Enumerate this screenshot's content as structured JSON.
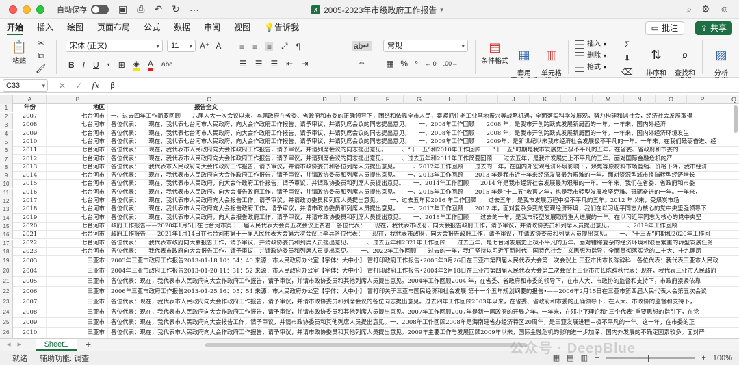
{
  "titlebar": {
    "autosave_label": "自动保存",
    "doc_title": "2005-2023年市级政府工作报告",
    "doc_badge": "X"
  },
  "menu": {
    "tabs": [
      "开始",
      "插入",
      "绘图",
      "页面布局",
      "公式",
      "数据",
      "审阅",
      "视图",
      "告诉我"
    ],
    "comment_label": "批注",
    "share_label": "共享"
  },
  "ribbon": {
    "paste_label": "粘贴",
    "font_name": "宋体 (正文)",
    "font_size": "11",
    "number_format": "常规",
    "conditional_format": "条件格式",
    "table_format": "套用\n表格格式",
    "cell_style": "单元格\n样式",
    "insert": "插入",
    "delete": "删除",
    "format": "格式",
    "sort_filter": "排序和\n筛选",
    "find_select": "查找和\n选择",
    "analyze_data": "分析\n数据"
  },
  "formula_bar": {
    "cell_ref": "C33",
    "fx": "fx",
    "value": "β"
  },
  "columns": [
    "A",
    "B",
    "C",
    "D",
    "E",
    "F",
    "G",
    "H",
    "I",
    "J",
    "K",
    "L",
    "M",
    "N",
    "O",
    "P",
    "Q"
  ],
  "sheet": {
    "header": {
      "num": "1",
      "year": "年份",
      "region": "地区",
      "text": "报告全文"
    },
    "rows": [
      {
        "num": "2",
        "year": "2007",
        "region": "七台河市",
        "text": "一、过去四年工作简要回顾　　八届人大一次会议以来，本届政府在省委、省政府和市委的正确领导下，团结和依靠全市人民，紧紧抓住老工业基地振兴等战略机遇，全面落实科学发展观，努力构建和谐社会，经济社会发展取得"
      },
      {
        "num": "3",
        "year": "2008",
        "region": "七台河市",
        "text": "各位代表：　　现在，我代表七台河市人民政府，向大会作政府工作报告，请予审议，并请列席会议的同志提出意见。　　一、2008年工作回顾　　2008 年，是我市开创跨跃式发展新局面的一年。一年来，国内外经济"
      },
      {
        "num": "4",
        "year": "2009",
        "region": "七台河市",
        "text": "各位代表：　　现在，我代表七台河市人民政府，向大会作政府工作报告，请予审议，并请列席会议的同志提出意见。　　一、2008年工作回顾　　2008 年，是我市开创跨跃式发展新局面的一年。一年来，国内外经济环境发生"
      },
      {
        "num": "5",
        "year": "2010",
        "region": "七台河市",
        "text": "各位代表：　　现在，我代表七台河市人民政府，向大会作政府工作报告，请予审议，并请列席会议的同志提出意见。　　一、2009年工作回顾　　2009年，是新世纪以来我市经济社会发展极不平凡的一年。一年来，在我们砥砺奋进、经"
      },
      {
        "num": "6",
        "year": "2011",
        "region": "七台河市",
        "text": "各位代表：　　现在，我代表市人民政府向大会作政府工作报告，请予审议，并请列席会议的同志提出意见。　　一、“十一五”和2010年工作回顾　　“十一五”时期是我市发展史上极不平凡的五年。在省委、省政府和市委的"
      },
      {
        "num": "7",
        "year": "2012",
        "region": "七台河市",
        "text": "各位代表：　　现在，我代表市人民政府向大会作政府工作报告，请予审议，并请列席会议的同志提出意见。　　一、过去五年和2011年工作简要回顾　　过去五年，是我市发展史上不平凡的五年。面对国际金融危机的严"
      },
      {
        "num": "8",
        "year": "2013",
        "region": "七台河市",
        "text": "各位代表：　　我代表市人民政府向大会作政府工作报告，请予审议，并请市政协委员和各位列席人员提出意见。　　一、2012年工作回顾　　过去的一年，在国内外宏观经济环境影响下，煤焦等原材料市场萎缩、价格下降，我市经济"
      },
      {
        "num": "9",
        "year": "2014",
        "region": "七台河市",
        "text": "各位代表：　　现在，我代表市人民政府向大会作政府工作报告，请予审议，并请政协委员和列席人员提出意见。　　一、2013年工作回顾　　2013 年是我市近十年来经济发展最为艰难的一年。面对资源型城市换挡转型经济增长"
      },
      {
        "num": "10",
        "year": "2015",
        "region": "七台河市",
        "text": "各位代表：　　现在，我代表市人民政府，向大会作政府工作报告，请予审议，并请政协委员和列席人员提出意见。　　一、2014年工作回顾　　2014 年是我市经济社会发展最为艰难的一年。一年来，我们在省委、省政府和市委"
      },
      {
        "num": "11",
        "year": "2016",
        "region": "七台河市",
        "text": "各位代表：　　现在，我代表市人民政府，向大会报告政府工作，请予审议，并请政协委员和列席人员提出意见。　　一、2015年工作回顾　　2015 年是“十二五”收官之年，也是我市转型发展攻坚克难、砥砺奋进的一年。一年来，"
      },
      {
        "num": "12",
        "year": "2017",
        "region": "七台河市",
        "text": "各位代表：　　现在，我代表市人民政府向大会报告工作，请予审议，并请政协委员和列席人员提出意见。　　一、过去五年和2016 年工作回顾　　过去五年，是我市发展历程中极不平凡的五年。2012 年以来，受煤炭市场"
      },
      {
        "num": "13",
        "year": "2018",
        "region": "七台河市",
        "text": "各位代表：　　现在，我代表市人民政府向大会报告政府工作，请予审议，并请市政协委员和列席人员提出意见。　　一、2017年工作回顾　　2017 年，面对复杂多变的宏观经济环境，我们在以习近平同志为核心的党中央坚强领导下"
      },
      {
        "num": "14",
        "year": "2019",
        "region": "七台河市",
        "text": "各位代表：　　现在，我代表市人民政府，向大会报告政府工作，请予审议，并请市政协委员和列席人员提出意见。　　一、2018年工作回顾　　过去的一年，是我市转型发展取得重大进展的一年。在以习近平同志为核心的党中央坚"
      },
      {
        "num": "15",
        "year": "2020",
        "region": "七台河市",
        "text": "政府工作报告——2020年1月5日在七台河市第十一届人民代表大会第五次会议上贾君　各位代表：　　现在，我代表市政府，向大会报告政府工作，请予审议，并请政协委员和列席人员提出意见。　　一、2019年工作回顾　　"
      },
      {
        "num": "16",
        "year": "2021",
        "region": "七台河市",
        "text": "政府工作报告——2021年1月14日在七台河市第十一届人民代表大会第六次会议上李兵各位代表：　　现在，我代表市政府，向大会报告政府工作，请予审议，并请政协委员和列席人员提出意见。　　一、“十三五”时期和2020年工作回"
      },
      {
        "num": "17",
        "year": "2022",
        "region": "七台河市",
        "text": "各位代表：　　我代表市政府向大会报告工作，请予审议，并请政协委员和列席人员提出意见。　　一、过去五年和2021年工作回顾　　过去五年，是七台河发展史上极不平凡的五年。面对错综复杂的经济环境和艰巨繁重的转型发展任务"
      },
      {
        "num": "18",
        "year": "2023",
        "region": "七台河市",
        "text": "各位代表：　　我代表市政府向大会报告工作，请予审议，并请政协委员和列席人员提出意见。　　一、2022年工作回顾　　过去的一年，我们坚持以习近平新时代中国特色社会主义思想为指导，全面贯彻落实党的二十大、十九届历"
      },
      {
        "num": "19",
        "year": "2003",
        "region": "三亚市",
        "text": "2003年三亚市政府工作报告2013-01-18 10：54：40 来源：市人民政府办公室【字体：大中小】 冒打印政府工作报告•2003年3月26日在三亚市第四届人民代表大会第一次会议上 三亚市代市长陈辞科　各位代表：我代表三亚市人民政"
      },
      {
        "num": "20",
        "year": "2004",
        "region": "三亚市",
        "text": "2004年三亚市政府工作报告2013-01-20 11：31：52 来源：市人民政府办公室【字体：大中小】 冒打印政府工作报告•2004年2月18日在三亚市第四届人民代表大会第二次会议上三亚市市长陈辞秋代表：现在，我代表三亚市人民政府"
      },
      {
        "num": "21",
        "year": "2005",
        "region": "三亚市",
        "text": "各位代表：现在，我代表市人民政府向大会作政府工作报告，请予审议，并请市政协委员和其他列席人员提出意见。2004年工作回顾2004 年，在省委、省政府和市委的领导下，在市人大、市政协的监督和支持下，市政府紧紧依靠"
      },
      {
        "num": "22",
        "year": "2006",
        "region": "三亚市",
        "text": "2006年三亚市政府工作报告2013-01-25 16：05：54 来源：市人民政府办公室【字体：大中小】 冒打印关于三亚市国民经济和社会发展 第十一个五年规划纲要的报告•——2006年2月15日在三亚市第四届人民代表大会第五次会议"
      },
      {
        "num": "23",
        "year": "2007",
        "region": "三亚市",
        "text": "各位代表：现在，我代表市人民政府向大会作政府工作报告，请予审议，并请市政协委员和列席会议的各位同志提出意见。过去四年工作回顾2003年以来，在省委、省政府和市委的正确领导下，在人大、市政协的监督和支持下，"
      },
      {
        "num": "24",
        "year": "2008",
        "region": "三亚市",
        "text": "各位代表：现在，我代表市人民政府向大会作政府工作报告，请予审议，并请市政协委员和其他列席人员提出意见。2007年工作回顾2007年是新一届政府的开局之年。一年来，在邓小平理论和“三个代表”重要思想的指引下，在党"
      },
      {
        "num": "25",
        "year": "2009",
        "region": "三亚市",
        "text": "各位代表：现在，我代表市人民政府向大会报告工作，请予审议，并请市政协委员和其他列席人员提出意见。一、2008年工作回顾2008年是海南建省办经济特区20周年，是三亚发展进程中极不平凡的一年。这一年，在市委的正"
      },
      {
        "num": "26",
        "year": "2010",
        "region": "三亚市",
        "text": "各位代表：现在，我代表市人民政府向大会作政府工作报告，请予审议，并请市政协委员和其他列席人员提出意见。2009年主要工作与发展回顾2009年以来，国际金融危机的影响进一步加深，国内外发展的不确定因素较多。面对严"
      },
      {
        "num": "27",
        "year": "2011",
        "region": "三亚市",
        "text": "各位代表：现在，我代表市人民政府向大会作政府工作报告，请各位代表连同《三亚市国民经济和社会发展第十二个五年规划纲要（草案）》一并审议，并请市政协委员和其他列席人员提出意见。2010年主要工作回顾2010年是国际"
      },
      {
        "num": "28",
        "year": "2012",
        "region": "三亚市",
        "text": "各位代表：现在，我代表市人民政府向大会作政府工作报告，请予审议，并请市政协委员和其他列席人员提出意见。一、过去五年工作回顾2007年以来，在中共三亚市委的正确领导下，在人大、市政协的监督支持下，市政府坚持科"
      },
      {
        "num": "29",
        "year": "2013",
        "region": "三亚市",
        "text": "各位代表：现在，我代表市人民政府向大会报告工作，请予审议，并请市政协委员和其他列席人员提出意见。一、2012年工作回顾2012年是三亚发展史上极不平凡的一年。面对复杂多变的宏观环境，我们在省委、省政府和市委"
      }
    ]
  },
  "sheet_tabs": {
    "active": "Sheet1",
    "add": "+"
  },
  "status": {
    "ready": "就绪",
    "accessibility": "辅助功能: 调查",
    "zoom": "100%"
  },
  "watermark": "公众号 · DeepBlue"
}
